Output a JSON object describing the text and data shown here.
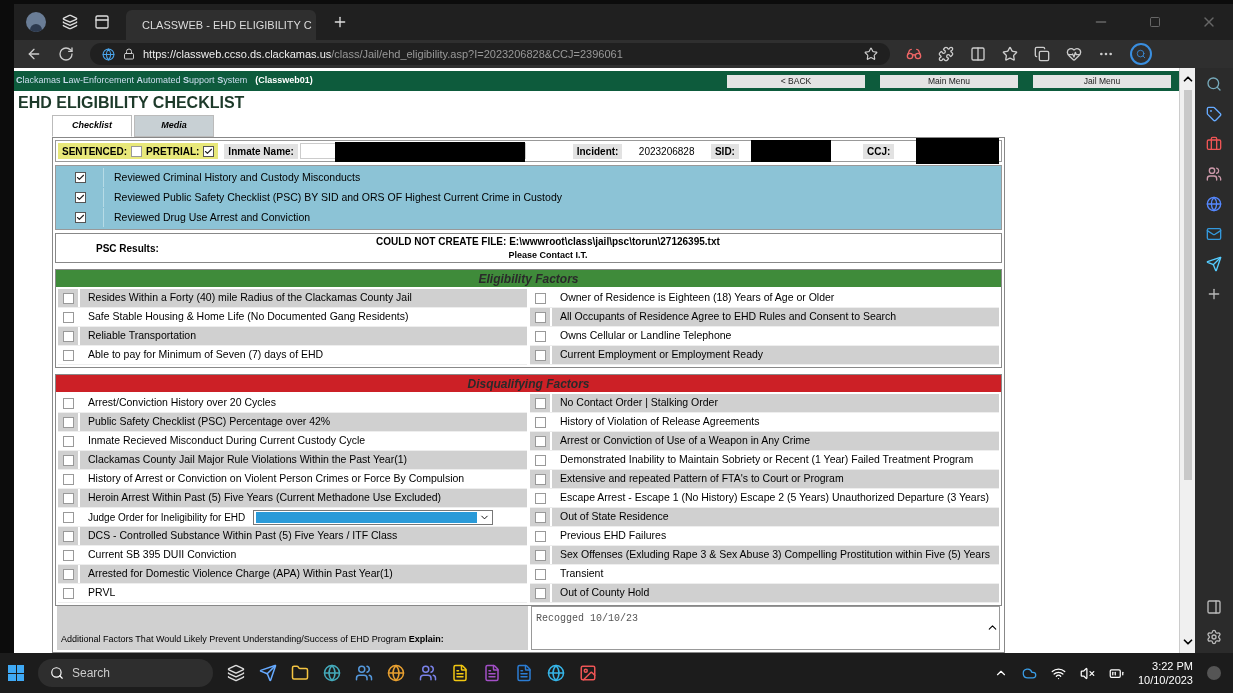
{
  "browser": {
    "tabs": [
      {
        "title": "CLASSWEB - EHD ELIGIBILITY C",
        "selected": true
      }
    ],
    "url_host": "https://classweb.ccso.ds.clackamas.us",
    "url_path": "/class/Jail/ehd_eligibility.asp?I=2023206828&CCJ=2396061"
  },
  "app_header": {
    "system_name": "**C**lackamas **L**aw-Enforcement **A**utomated **S**upport **S**ystem",
    "instance": "(Classweb01)",
    "nav_buttons": [
      "< BACK",
      "Main Menu",
      "Jail Menu"
    ]
  },
  "page_title": "EHD ELIGIBILITY CHECKLIST",
  "tabs": [
    {
      "label": "Checklist",
      "selected": true
    },
    {
      "label": "Media",
      "selected": false
    }
  ],
  "status": {
    "sentenced_label": "SENTENCED:",
    "sentenced": false,
    "pretrial_label": "PRETRIAL:",
    "pretrial": true
  },
  "inmate": {
    "name_label": "Inmate Name:",
    "incident_label": "Incident:",
    "incident": "2023206828",
    "sid_label": "SID:",
    "ccj_label": "CCJ:"
  },
  "reviewed": [
    {
      "label": "Reviewed Criminal History and Custody Misconducts",
      "checked": true
    },
    {
      "label": "Reviewed Public Safety Checklist (PSC) BY SID and ORS OF Highest Current Crime in Custody",
      "checked": true
    },
    {
      "label": "Reviewed Drug Use Arrest and Conviction",
      "checked": true
    }
  ],
  "psc": {
    "label": "PSC Results:",
    "message": "COULD NOT CREATE FILE: E:\\wwwroot\\class\\jail\\psc\\torun\\27126395.txt",
    "note": "Please Contact I.T."
  },
  "eligibility": {
    "title": "Eligibility Factors",
    "left": [
      {
        "kind": "check",
        "label": "Resides Within a Forty (40) mile Radius of the Clackamas County Jail",
        "checked": false
      },
      {
        "kind": "check",
        "label": "Safe Stable Housing & Home Life (No Documented Gang Residents)",
        "checked": false
      },
      {
        "kind": "check",
        "label": "Reliable Transportation",
        "checked": false
      },
      {
        "kind": "check",
        "label": "Able to pay for Minimum of Seven (7) days of EHD",
        "checked": false
      }
    ],
    "right": [
      {
        "kind": "check",
        "label": "Owner of Residence is Eighteen (18) Years of Age or Older",
        "checked": false
      },
      {
        "kind": "check",
        "label": "All Occupants of Residence Agree to EHD Rules and Consent to Search",
        "checked": false
      },
      {
        "kind": "check",
        "label": "Owns Cellular or Landline Telephone",
        "checked": false
      },
      {
        "kind": "check",
        "label": "Current Employment or Employment Ready",
        "checked": false
      }
    ]
  },
  "disqualifying": {
    "title": "Disqualifying Factors",
    "left": [
      {
        "kind": "check",
        "label": "Arrest/Conviction History over 20 Cycles",
        "checked": false
      },
      {
        "kind": "check",
        "label": "Public Safety Checklist (PSC) Percentage over 42%",
        "checked": false
      },
      {
        "kind": "check",
        "label": "Inmate Recieved Misconduct During Current Custody Cycle",
        "checked": false
      },
      {
        "kind": "check",
        "label": "Clackamas County Jail Major Rule Violations Within the Past Year(1)",
        "checked": false
      },
      {
        "kind": "check",
        "label": "History of Arrest or Conviction on Violent Person Crimes or Force By Compulsion",
        "checked": false
      },
      {
        "kind": "check",
        "label": "Heroin Arrest Within Past (5) Five Years (Current Methadone Use Excluded)",
        "checked": false
      },
      {
        "kind": "dropdown",
        "label": "Judge Order for Ineligibility for EHD",
        "checked": false
      },
      {
        "kind": "check",
        "label": "DCS - Controlled Substance Within Past (5) Five Years / ITF Class",
        "checked": false
      },
      {
        "kind": "check",
        "label": "Current SB 395 DUII Conviction",
        "checked": false
      },
      {
        "kind": "check",
        "label": "Arrested for Domestic Violence Charge (APA) Within Past Year(1)",
        "checked": false
      },
      {
        "kind": "check",
        "label": "PRVL",
        "checked": false
      }
    ],
    "right": [
      {
        "kind": "check",
        "label": "No Contact Order | Stalking Order",
        "checked": false
      },
      {
        "kind": "check",
        "label": "History of Violation of Release Agreements",
        "checked": false
      },
      {
        "kind": "check",
        "label": "Arrest or Conviction of Use of a Weapon in Any Crime",
        "checked": false
      },
      {
        "kind": "check",
        "label": "Demonstrated Inability to Maintain Sobriety or Recent (1 Year) Failed Treatment Program",
        "checked": false
      },
      {
        "kind": "check",
        "label": "Extensive and repeated Pattern of FTA's to Court or Program",
        "checked": false
      },
      {
        "kind": "check",
        "label": "Escape Arrest - Escape 1 (No History) Escape 2 (5 Years) Unauthorized Departure (3 Years)",
        "checked": false
      },
      {
        "kind": "check",
        "label": "Out of State Residence",
        "checked": false
      },
      {
        "kind": "check",
        "label": "Previous EHD Failures",
        "checked": false
      },
      {
        "kind": "check",
        "label": "Sex Offenses (Exluding Rape 3 & Sex Abuse 3) Compelling Prostitution within Five (5) Years",
        "checked": false
      },
      {
        "kind": "check",
        "label": "Transient",
        "checked": false
      },
      {
        "kind": "check",
        "label": "Out of County Hold",
        "checked": false
      }
    ]
  },
  "additional": {
    "label": "Additional Factors That Would Likely Prevent Understanding/Success of EHD Program **Explain:**",
    "value": "Recogged 10/10/23"
  },
  "taskbar": {
    "search_placeholder": "Search",
    "time": "3:22 PM",
    "date": "10/10/2023"
  }
}
